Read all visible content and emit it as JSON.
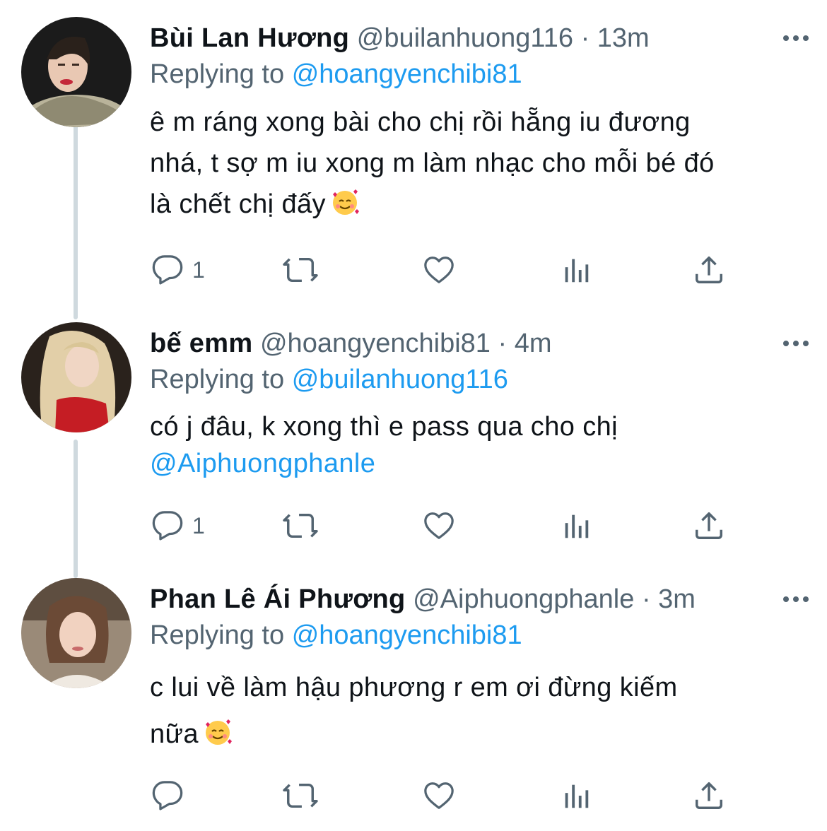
{
  "tweets": [
    {
      "name": "Bùi Lan Hương",
      "handle": "@builanhuong116",
      "separator": "·",
      "time": "13m",
      "replying_prefix": "Replying to",
      "replying_to": "@hoangyenchibi81",
      "body_lines": [
        "ê m ráng xong bài cho chị rồi hẵng iu đương",
        "nhá, t sợ m iu xong m làm nhạc cho mỗi bé đó",
        "là chết chị đấy"
      ],
      "emoji": "smiling-face-with-hearts",
      "reply_count": "1"
    },
    {
      "name": "bế emm",
      "handle": "@hoangyenchibi81",
      "separator": "·",
      "time": "4m",
      "replying_prefix": "Replying to",
      "replying_to": "@builanhuong116",
      "body_lines": [
        "có j đâu, k xong thì e pass qua cho chị"
      ],
      "body_mention": "@Aiphuongphanle",
      "reply_count": "1"
    },
    {
      "name": "Phan Lê Ái Phương",
      "handle": "@Aiphuongphanle",
      "separator": "·",
      "time": "3m",
      "replying_prefix": "Replying to",
      "replying_to": "@hoangyenchibi81",
      "body_lines": [
        "c lui về làm hậu phương r em ơi đừng kiếm",
        "nữa"
      ],
      "emoji": "smiling-face-with-hearts",
      "reply_count": ""
    }
  ],
  "icons": {
    "reply": "reply-icon",
    "retweet": "retweet-icon",
    "like": "like-icon",
    "analytics": "analytics-icon",
    "share": "share-icon",
    "more": "more-icon"
  },
  "colors": {
    "accent": "#1d9bf0",
    "secondary_text": "#536471",
    "primary_text": "#0f1419",
    "thread_line": "#cfd9de"
  }
}
